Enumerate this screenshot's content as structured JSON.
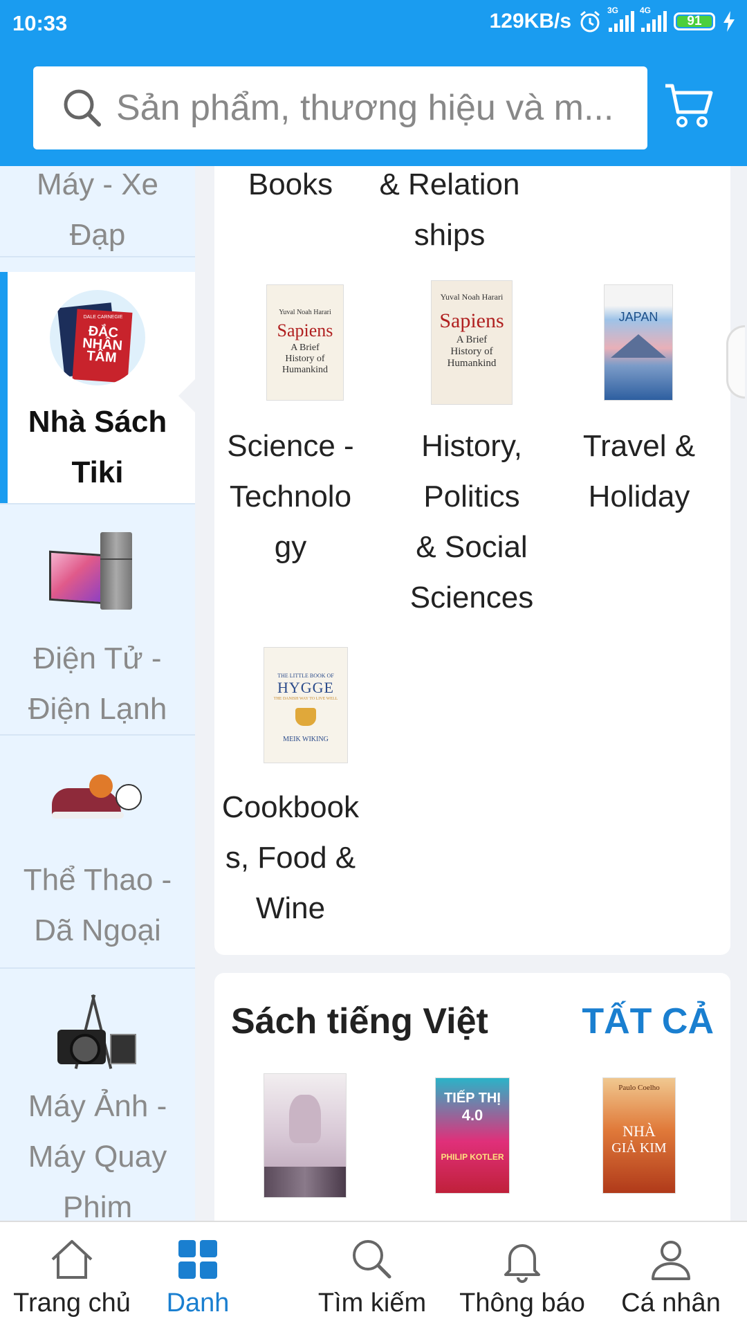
{
  "status": {
    "time": "10:33",
    "speed": "129KB/s",
    "net1": "3G",
    "net2": "4G",
    "battery": "91"
  },
  "search": {
    "placeholder": "Sản phẩm, thương hiệu và m..."
  },
  "sidebar": {
    "items": [
      {
        "label_l1": "Máy - Xe",
        "label_l2": "Đạp"
      },
      {
        "label_l1": "Nhà Sách",
        "label_l2": "Tiki"
      },
      {
        "label_l1": "Điện Tử -",
        "label_l2": "Điện Lạnh"
      },
      {
        "label_l1": "Thể Thao -",
        "label_l2": "Dã Ngoại"
      },
      {
        "label_l1": "Máy Ảnh -",
        "label_l2": "Máy Quay",
        "label_l3": "Phim"
      }
    ]
  },
  "thumb_text": {
    "dac": "ĐẮC",
    "nhan": "NHÂN",
    "tam": "TÂM",
    "dale": "DALE CARNEGIE"
  },
  "panel": {
    "top_left": "Books",
    "top_mid_l1": "& Relation",
    "top_mid_l2": "ships",
    "categories": [
      {
        "l1": "Science -",
        "l2": "Technolo",
        "l3": "gy"
      },
      {
        "l1": "History,",
        "l2": "Politics",
        "l3": "& Social",
        "l4": "Sciences"
      },
      {
        "l1": "Travel &",
        "l2": "Holiday"
      },
      {
        "l1": "Cookbook",
        "l2": "s, Food &",
        "l3": "Wine"
      }
    ],
    "book_sapiens": {
      "author": "Yuval Noah Harari",
      "title": "Sapiens",
      "sub1": "A Brief",
      "sub2": "History of",
      "sub3": "Humankind"
    },
    "book_japan": {
      "title": "JAPAN"
    },
    "book_hygge": {
      "top": "THE LITTLE BOOK OF",
      "title": "HYGGE",
      "sub": "THE DANISH WAY TO LIVE WELL",
      "author": "MEIK WIKING"
    }
  },
  "section2": {
    "title": "Sách tiếng Việt",
    "all": "TẤT CẢ"
  },
  "vn_books": {
    "tiepthi": "TIẾP THỊ",
    "tiepthi_ver": "4.0",
    "kotler": "PHILIP KOTLER",
    "coelho": "Paulo Coelho",
    "nha": "NHÀ",
    "giakim": "GIẢ KIM"
  },
  "nav": [
    {
      "label": "Trang chủ"
    },
    {
      "label": "Danh"
    },
    {
      "label": "Tìm kiếm"
    },
    {
      "label": "Thông báo"
    },
    {
      "label": "Cá nhân"
    }
  ],
  "colors": {
    "brand": "#1a9cf0",
    "accent_text": "#1a7fd0",
    "sidebar_bg": "#e9f4ff"
  }
}
